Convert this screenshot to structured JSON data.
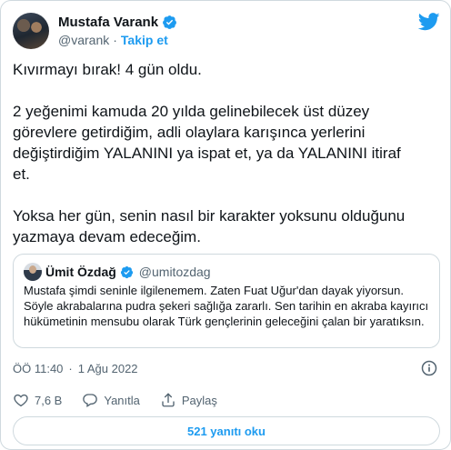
{
  "author": {
    "name": "Mustafa Varank",
    "handle": "@varank",
    "separator": "·",
    "follow_label": "Takip et"
  },
  "tweet": {
    "text": "Kıvırmayı bırak! 4 gün oldu.\n\n2 yeğenimi kamuda 20 yılda gelinebilecek üst düzey\ngörevlere getirdiğim, adli olaylara karışınca yerlerini\ndeğiştirdiğim YALANINI ya ispat et, ya da YALANINI itiraf\net.\n\nYoksa her gün, senin nasıl bir karakter yoksunu olduğunu\nyazmaya devam edeceğim."
  },
  "quote": {
    "name": "Ümit Özdağ",
    "handle": "@umitozdag",
    "text": "Mustafa şimdi seninle ilgilenemem. Zaten Fuat Uğur'dan dayak yiyorsun. Söyle akrabalarına pudra şekeri sağlığa zararlı. Sen tarihin en akraba kayırıcı hükümetinin mensubu olarak Türk gençlerinin geleceğini çalan bir yaratıksın."
  },
  "meta": {
    "time": "ÖÖ 11:40",
    "separator": "·",
    "date": "1 Ağu 2022"
  },
  "actions": {
    "likes": "7,6 B",
    "reply_label": "Yanıtla",
    "share_label": "Paylaş"
  },
  "read_replies_label": "521 yanıtı oku",
  "colors": {
    "accent": "#1d9bf0",
    "secondary_text": "#536471",
    "border": "#cfd9de"
  }
}
